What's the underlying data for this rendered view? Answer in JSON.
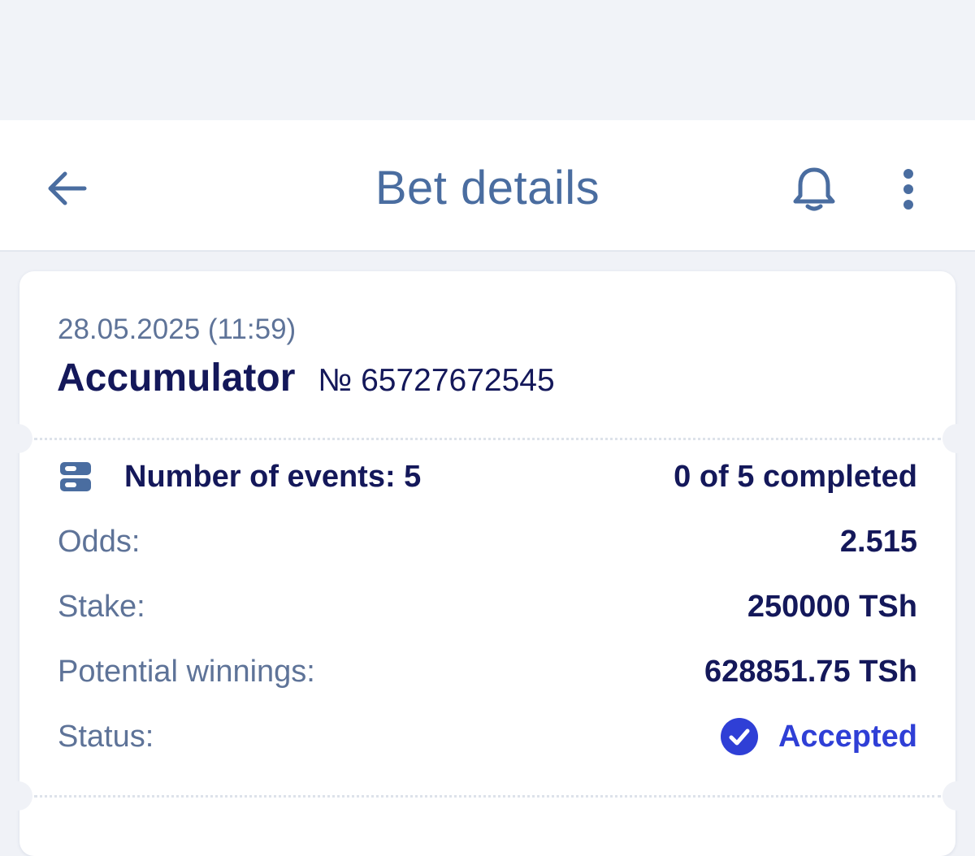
{
  "colors": {
    "title": "#4a6da0",
    "primary_text": "#14185a",
    "secondary_text": "#5e7398",
    "accent": "#2f3fd6",
    "background": "#f0f2f7"
  },
  "header": {
    "title": "Bet details",
    "back_icon": "arrow-left-icon",
    "notifications_icon": "bell-icon",
    "menu_icon": "more-vertical-icon"
  },
  "bet": {
    "date": "28.05.2025 (11:59)",
    "type": "Accumulator",
    "number": "№ 65727672545",
    "events_label": "Number of events: 5",
    "events_icon": "events-list-icon",
    "completed": "0 of 5 completed",
    "rows": [
      {
        "label": "Odds:",
        "value": "2.515"
      },
      {
        "label": "Stake:",
        "value": "250000 TSh"
      },
      {
        "label": "Potential winnings:",
        "value": "628851.75 TSh"
      }
    ],
    "status_label": "Status:",
    "status_value": "Accepted",
    "status_icon": "check-circle-icon"
  }
}
